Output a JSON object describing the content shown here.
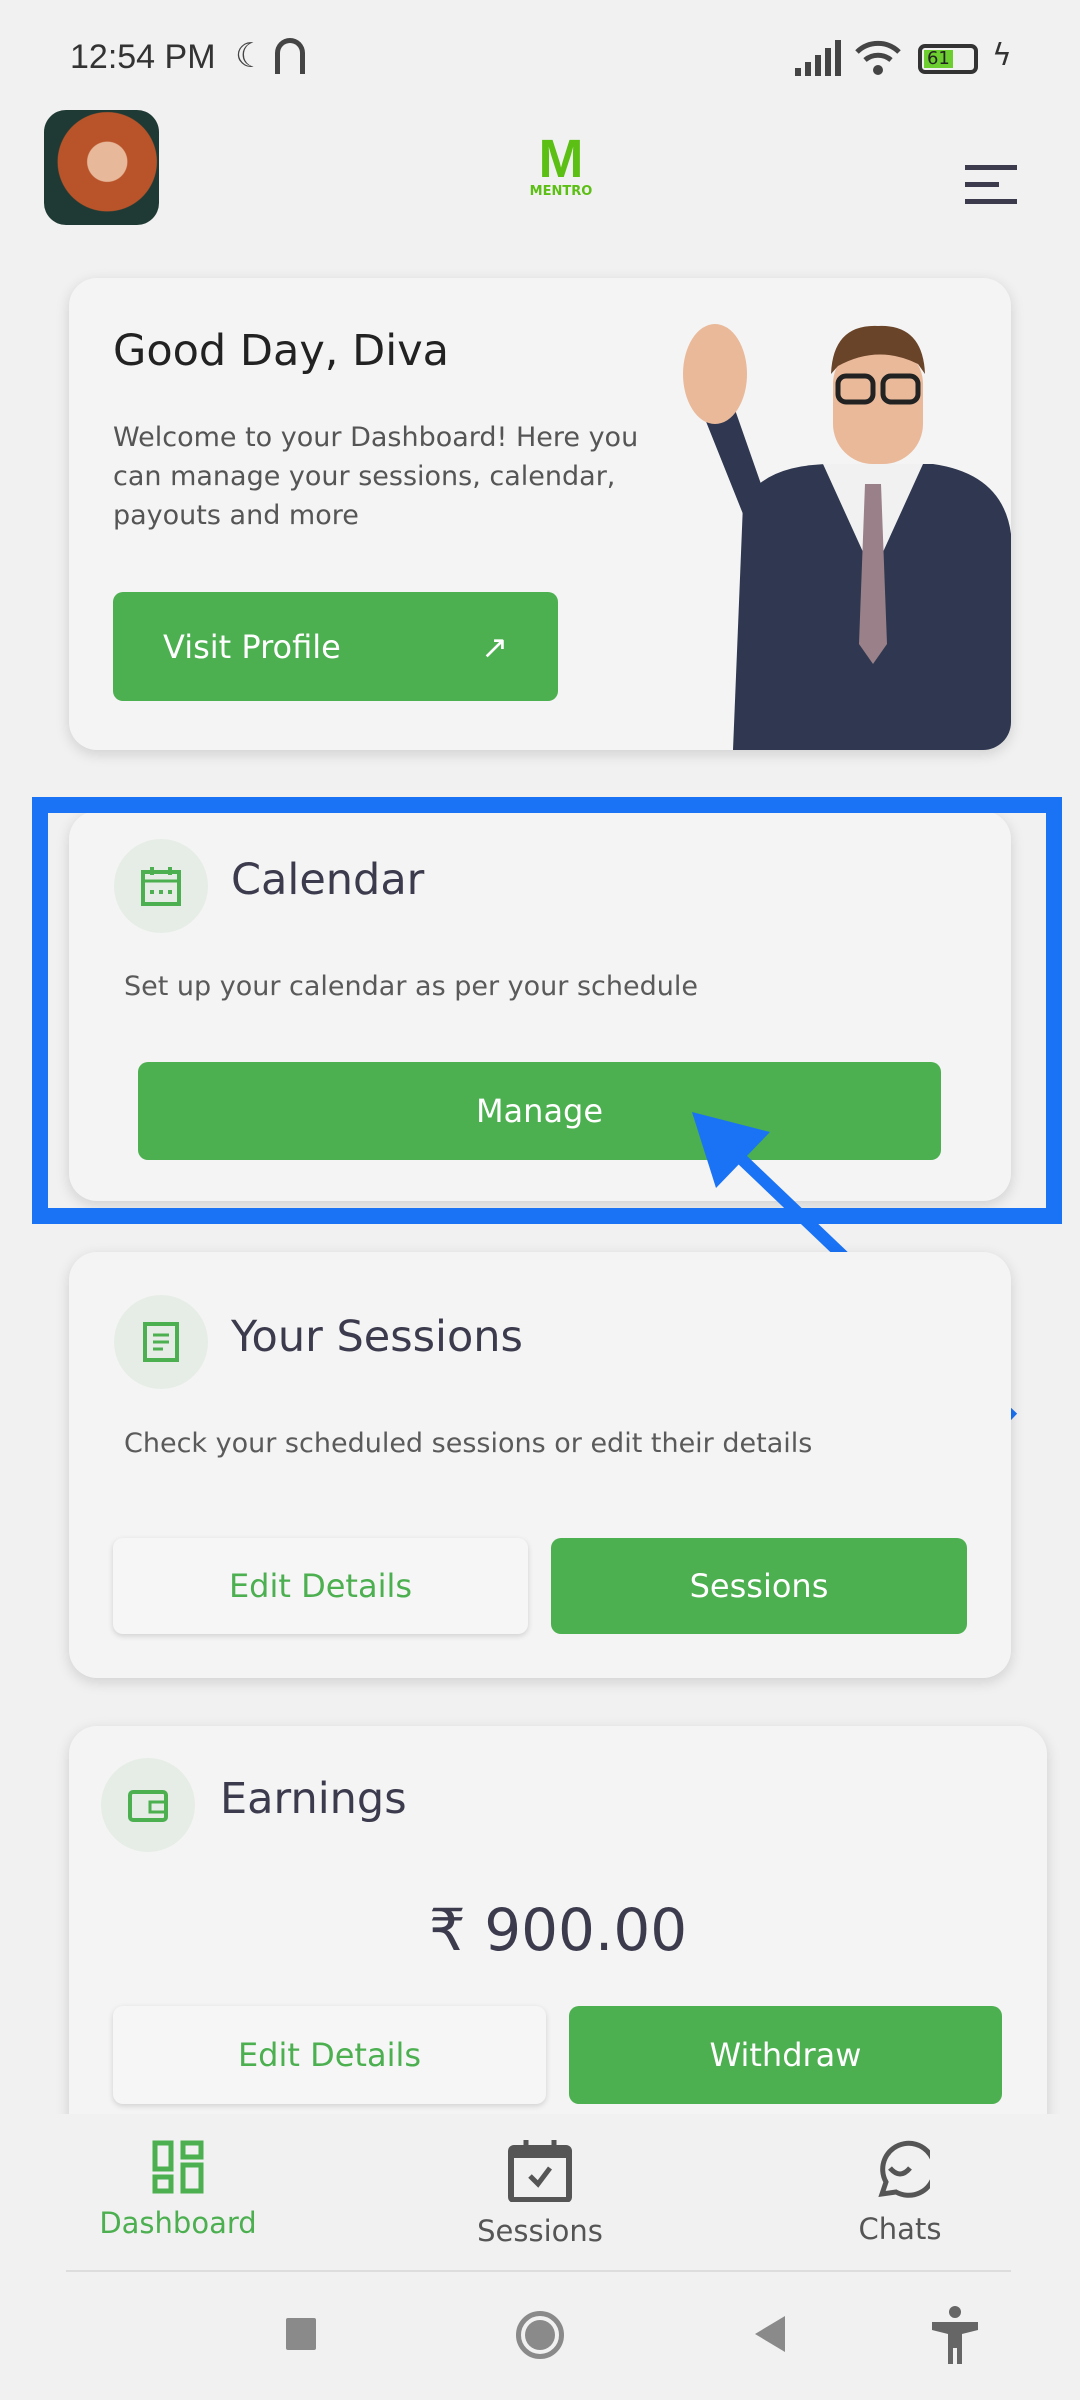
{
  "status_bar": {
    "time": "12:54 PM",
    "battery": "61"
  },
  "header": {
    "logo_text": "MENTRO"
  },
  "welcome": {
    "title": "Good Day, Diva",
    "description": "Welcome to your Dashboard! Here you can manage your sessions, calendar, payouts and more",
    "button": "Visit Profile"
  },
  "calendar": {
    "title": "Calendar",
    "description": "Set up your calendar as per your schedule",
    "button": "Manage"
  },
  "sessions": {
    "title": "Your Sessions",
    "description": "Check your scheduled sessions or edit their details",
    "edit_button": "Edit Details",
    "sessions_button": "Sessions"
  },
  "earnings": {
    "title": "Earnings",
    "amount": "₹ 900.00",
    "edit_button": "Edit Details",
    "withdraw_button": "Withdraw"
  },
  "bottom_nav": [
    {
      "label": "Dashboard",
      "icon": "dashboard-icon",
      "active": true
    },
    {
      "label": "Sessions",
      "icon": "calendar-check-icon"
    },
    {
      "label": "Chats",
      "icon": "chat-icon"
    }
  ],
  "colors": {
    "accent": "#4caf50",
    "highlight": "#1a73f5"
  }
}
